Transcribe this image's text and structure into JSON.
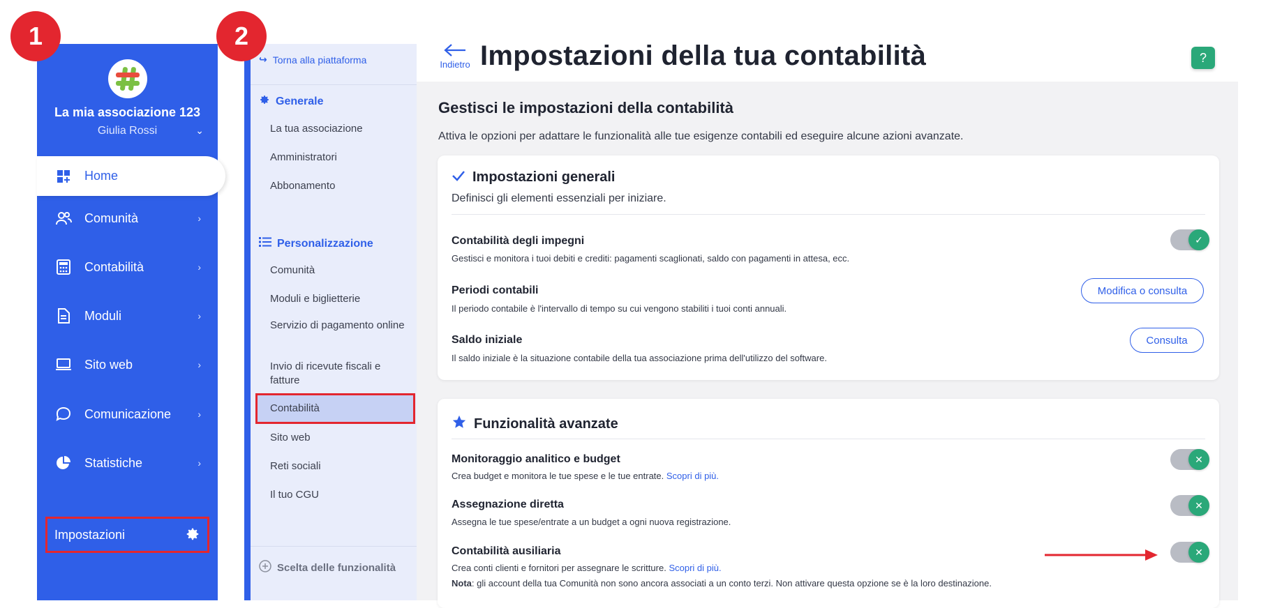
{
  "badges": {
    "one": "1",
    "two": "2"
  },
  "main_sidebar": {
    "org_name": "La mia associazione 123",
    "user_name": "Giulia Rossi",
    "home_label": "Home",
    "items": [
      {
        "label": "Comunità",
        "icon": "users-icon"
      },
      {
        "label": "Contabilità",
        "icon": "calculator-icon"
      },
      {
        "label": "Moduli",
        "icon": "document-icon"
      },
      {
        "label": "Sito web",
        "icon": "laptop-icon"
      },
      {
        "label": "Comunicazione",
        "icon": "chat-icon"
      },
      {
        "label": "Statistiche",
        "icon": "pie-chart-icon"
      }
    ],
    "settings_label": "Impostazioni"
  },
  "sub_sidebar": {
    "back_label": "Torna alla piattaforma",
    "general_title": "Generale",
    "general_items": [
      "La tua associazione",
      "Amministratori",
      "Abbonamento"
    ],
    "custom_title": "Personalizzazione",
    "custom_items": [
      "Comunità",
      "Moduli e biglietterie",
      "Servizio di pagamento online",
      "Invio di ricevute fiscali e fatture",
      "Contabilità",
      "Sito web",
      "Reti sociali",
      "Il tuo CGU"
    ],
    "active_item": "Contabilità",
    "feature_choice": "Scelta delle funzionalità"
  },
  "header": {
    "back_label": "Indietro",
    "title": "Impostazioni della tua contabilità",
    "help_label": "?"
  },
  "content": {
    "heading": "Gestisci le impostazioni della contabilità",
    "description": "Attiva le opzioni per adattare le funzionalità alle tue esigenze contabili ed eseguire alcune azioni avanzate.",
    "general_card": {
      "title": "Impostazioni generali",
      "subtitle": "Definisci gli elementi essenziali per iniziare.",
      "rows": [
        {
          "title": "Contabilità degli impegni",
          "desc": "Gestisci e monitora i tuoi debiti e crediti: pagamenti scaglionati, saldo con pagamenti in attesa, ecc."
        },
        {
          "title": "Periodi contabili",
          "desc": "Il periodo contabile è l'intervallo di tempo su cui vengono stabiliti i tuoi conti annuali.",
          "button": "Modifica o consulta"
        },
        {
          "title": "Saldo iniziale",
          "desc": "Il saldo iniziale è la situazione contabile della tua associazione prima dell'utilizzo del software.",
          "button": "Consulta"
        }
      ]
    },
    "advanced_card": {
      "title": "Funzionalità avanzate",
      "rows": [
        {
          "title": "Monitoraggio analitico e budget",
          "desc": "Crea budget e monitora le tue spese e le tue entrate.",
          "link": "Scopri di più."
        },
        {
          "title": "Assegnazione diretta",
          "desc": "Assegna le tue spese/entrate a un budget a ogni nuova registrazione."
        },
        {
          "title": "Contabilità ausiliaria",
          "desc": "Crea conti clienti e fornitori per assegnare le scritture.",
          "link": "Scopri di più.",
          "note_label": "Nota",
          "note": ": gli account della tua Comunità non sono ancora associati a un conto terzi. Non attivare questa opzione se è la loro destinazione."
        }
      ]
    }
  },
  "colors": {
    "brand_blue": "#2f5fe8",
    "highlight_red": "#e3262f",
    "toggle_green": "#2aa879"
  }
}
